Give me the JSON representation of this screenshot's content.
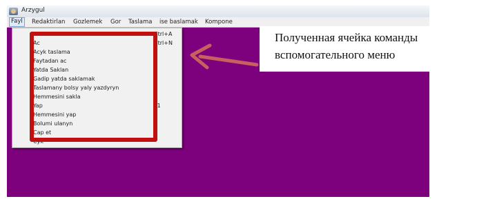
{
  "window": {
    "title": "Arzygul",
    "background_color": "#7d007d"
  },
  "menu_bar": {
    "items": [
      {
        "label": "Fayl",
        "active": true
      },
      {
        "label": "Redaktirlan"
      },
      {
        "label": "Gozlemek"
      },
      {
        "label": "Gor"
      },
      {
        "label": "Taslama"
      },
      {
        "label": "ise baslamak"
      },
      {
        "label": "Kompone"
      }
    ]
  },
  "file_menu": {
    "items": [
      {
        "label": "Taze",
        "shortcut": "Ctrl+A"
      },
      {
        "label": "Ac",
        "shortcut": "Ctrl+N"
      },
      {
        "label": "Acyk taslama",
        "shortcut": ""
      },
      {
        "label": "Faytadan ac",
        "shortcut": ""
      },
      {
        "label": "Yatda Saklan",
        "shortcut": ""
      },
      {
        "label": "Gadip yatda saklamak",
        "shortcut": ""
      },
      {
        "label": "Taslamany bolsy yaly yazdyryn",
        "shortcut": ""
      },
      {
        "label": "Hemmesini sakla",
        "shortcut": ""
      },
      {
        "label": "Yap",
        "shortcut": "F1"
      },
      {
        "label": "Hemmesini yap",
        "shortcut": ""
      },
      {
        "label": "Bolumi ulanyn",
        "shortcut": ""
      },
      {
        "label": "Cap et",
        "shortcut": ""
      },
      {
        "label": "Cyk",
        "shortcut": ""
      }
    ]
  },
  "annotation": {
    "text": "Полученная ячейка команды вспомогательного меню",
    "highlight_color": "#c01010",
    "arrow_color": "#c86060"
  }
}
